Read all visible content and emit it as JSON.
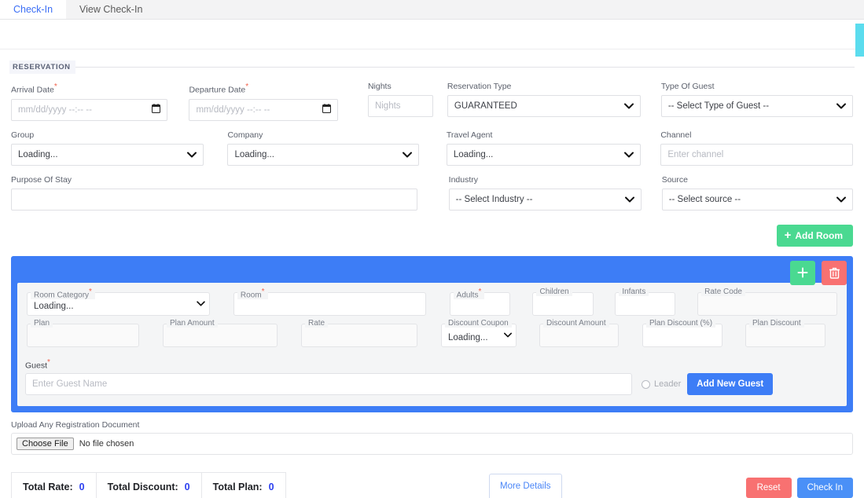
{
  "tabs": [
    {
      "label": "Check-In",
      "active": true
    },
    {
      "label": "View Check-In",
      "active": false
    }
  ],
  "reservation": {
    "legend": "RESERVATION",
    "fields": {
      "arrival_date": {
        "label": "Arrival Date",
        "required": true,
        "value": "mm/dd/yyyy --:-- --",
        "icon": "calendar-icon"
      },
      "departure_date": {
        "label": "Departure Date",
        "required": true,
        "value": "mm/dd/yyyy --:-- --",
        "icon": "calendar-icon"
      },
      "nights": {
        "label": "Nights",
        "required": false,
        "placeholder": "Nights",
        "value": ""
      },
      "reservation_type": {
        "label": "Reservation Type",
        "required": false,
        "value": "GUARANTEED"
      },
      "type_of_guest": {
        "label": "Type Of Guest",
        "required": false,
        "value": "-- Select Type of Guest --"
      },
      "group": {
        "label": "Group",
        "required": false,
        "value": "Loading..."
      },
      "company": {
        "label": "Company",
        "required": false,
        "value": "Loading..."
      },
      "travel_agent": {
        "label": "Travel Agent",
        "required": false,
        "value": "Loading..."
      },
      "channel": {
        "label": "Channel",
        "required": false,
        "placeholder": "Enter channel",
        "value": ""
      },
      "purpose_of_stay": {
        "label": "Purpose Of Stay",
        "required": false,
        "value": ""
      },
      "industry": {
        "label": "Industry",
        "required": false,
        "value": "-- Select Industry --"
      },
      "source": {
        "label": "Source",
        "required": false,
        "value": "-- Select source --"
      }
    },
    "add_room_button": "Add Room"
  },
  "room_panel": {
    "add_button_icon": "plus-icon",
    "delete_button_icon": "trash-icon",
    "fields": {
      "room_category": {
        "label": "Room Category",
        "required": true,
        "value": "Loading..."
      },
      "room": {
        "label": "Room",
        "required": true,
        "value": ""
      },
      "adults": {
        "label": "Adults",
        "required": true,
        "value": ""
      },
      "children": {
        "label": "Children",
        "required": false,
        "value": ""
      },
      "infants": {
        "label": "Infants",
        "required": false,
        "value": ""
      },
      "rate_code": {
        "label": "Rate Code",
        "required": false,
        "value": ""
      },
      "plan": {
        "label": "Plan",
        "required": false,
        "value": ""
      },
      "plan_amount": {
        "label": "Plan Amount",
        "required": false,
        "value": ""
      },
      "rate": {
        "label": "Rate",
        "required": false,
        "value": ""
      },
      "discount_coupon": {
        "label": "Discount Coupon",
        "required": false,
        "value": "Loading..."
      },
      "discount_amount": {
        "label": "Discount Amount",
        "required": false,
        "value": ""
      },
      "plan_discount_pct": {
        "label": "Plan Discount (%)",
        "required": false,
        "value": ""
      },
      "plan_discount": {
        "label": "Plan Discount",
        "required": false,
        "value": ""
      }
    },
    "guest": {
      "label": "Guest",
      "required": true,
      "placeholder": "Enter Guest Name",
      "value": "",
      "leader_label": "Leader",
      "add_new_guest_button": "Add New Guest"
    }
  },
  "upload": {
    "label": "Upload Any Registration Document",
    "choose_file_button": "Choose File",
    "file_status": "No file chosen"
  },
  "totals": [
    {
      "label": "Total Rate:",
      "value": "0"
    },
    {
      "label": "Total Discount:",
      "value": "0"
    },
    {
      "label": "Total Plan:",
      "value": "0"
    }
  ],
  "footer": {
    "more_details": "More Details",
    "reset_button": "Reset",
    "check_in_button": "Check In"
  },
  "colors": {
    "accent_blue": "#3d7df6",
    "link_blue": "#4a86f7",
    "green": "#4ad991",
    "red": "#f87171",
    "scrollbar": "#5bdcee",
    "required": "#f0614b",
    "total_value": "#2b3ff0"
  }
}
